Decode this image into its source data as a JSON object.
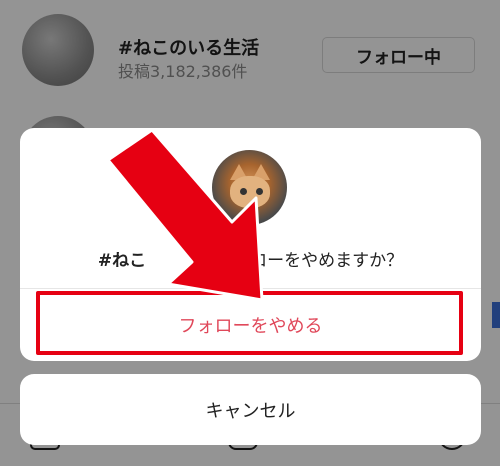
{
  "background": {
    "row1": {
      "title": "#ねこのいる生活",
      "subtitle": "投稿3,182,386件",
      "follow_button": "フォロー中"
    }
  },
  "dialog": {
    "message_prefix": "#ねこ",
    "message_suffix": "フォローをやめますか？",
    "unfollow_button": "フォローをやめる",
    "cancel_button": "キャンセル"
  },
  "colors": {
    "unfollow_text": "#e0485a",
    "highlight_border": "#e60012",
    "arrow": "#e60012"
  }
}
